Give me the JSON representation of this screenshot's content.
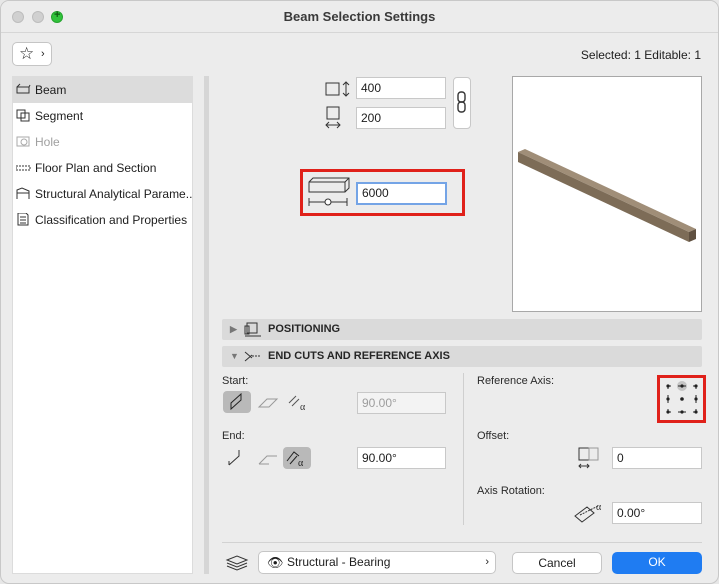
{
  "window": {
    "title": "Beam Selection Settings"
  },
  "header": {
    "favorites_icon": "star-icon",
    "selection_info": "Selected: 1 Editable: 1"
  },
  "sidebar": {
    "items": [
      {
        "label": "Beam",
        "icon": "beam-icon"
      },
      {
        "label": "Segment",
        "icon": "segment-icon"
      },
      {
        "label": "Hole",
        "icon": "hole-icon"
      },
      {
        "label": "Floor Plan and Section",
        "icon": "floor-plan-icon"
      },
      {
        "label": "Structural Analytical Parame...",
        "icon": "structural-analytical-icon"
      },
      {
        "label": "Classification and Properties",
        "icon": "classification-icon"
      }
    ],
    "selected": "Beam"
  },
  "dimensions": {
    "height": "400",
    "width": "200",
    "length": "6000"
  },
  "sections": {
    "positioning": "POSITIONING",
    "end_cuts": "END CUTS AND REFERENCE AXIS"
  },
  "end_cuts": {
    "start_label": "Start:",
    "start_angle": "90.00°",
    "end_label": "End:",
    "end_angle": "90.00°",
    "reference_axis_label": "Reference Axis:",
    "offset_label": "Offset:",
    "offset_value": "0",
    "axis_rotation_label": "Axis Rotation:",
    "axis_rotation_value": "0.00°"
  },
  "footer": {
    "layer_value": "Structural - Bearing",
    "cancel": "Cancel",
    "ok": "OK"
  },
  "colors": {
    "highlight": "#e0211a",
    "ok_button": "#1f7cf2",
    "beam": "#8a7a66"
  }
}
